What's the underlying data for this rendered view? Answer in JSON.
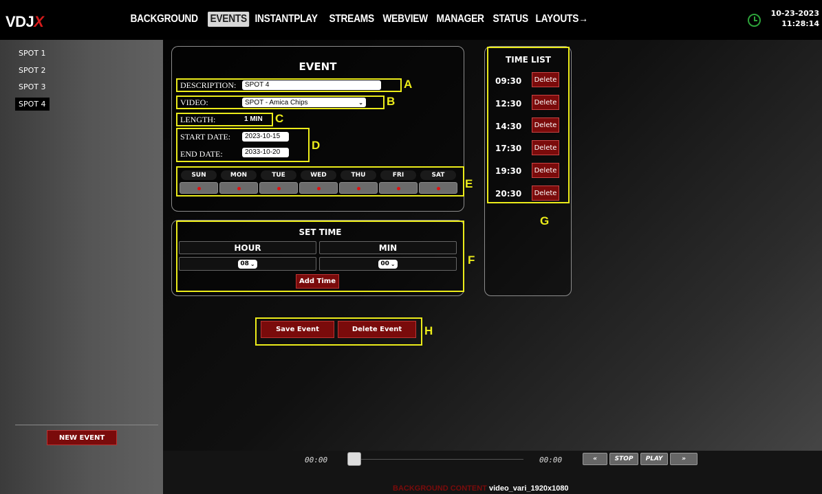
{
  "app": {
    "logo_main": "VDJ",
    "logo_accent": "X"
  },
  "nav": {
    "tabs": [
      "BACKGROUND",
      "EVENTS",
      "INSTANTPLAY",
      "STREAMS",
      "WEBVIEW",
      "MANAGER",
      "STATUS",
      "LAYOUTS→"
    ],
    "active_index": 1
  },
  "datetime": {
    "date": "10-23-2023",
    "time": "11:28:14"
  },
  "status_icon": "clock-icon",
  "sidebar": {
    "spots": [
      "SPOT 1",
      "SPOT 2",
      "SPOT 3",
      "SPOT 4"
    ],
    "active_index": 3,
    "new_event_label": "NEW EVENT"
  },
  "event": {
    "title": "EVENT",
    "description_label": "DESCRIPTION:",
    "description_value": "SPOT 4",
    "video_label": "VIDEO:",
    "video_value": "SPOT - Amica Chips",
    "length_label": "LENGTH:",
    "length_value": "1 MIN",
    "start_label": "START DATE:",
    "start_value": "2023-10-15",
    "end_label": "END DATE:",
    "end_value": "2033-10-20",
    "days": [
      "SUN",
      "MON",
      "TUE",
      "WED",
      "THU",
      "FRI",
      "SAT"
    ]
  },
  "set_time": {
    "title": "SET TIME",
    "hour_label": "HOUR",
    "min_label": "MIN",
    "hour_value": "08",
    "min_value": "00",
    "add_label": "Add Time"
  },
  "time_list": {
    "title": "TIME LIST",
    "times": [
      "09:30",
      "12:30",
      "14:30",
      "17:30",
      "19:30",
      "20:30"
    ],
    "delete_label": "Delete"
  },
  "actions": {
    "save_label": "Save Event",
    "delete_label": "Delete Event"
  },
  "annotations": {
    "A": "A",
    "B": "B",
    "C": "C",
    "D": "D",
    "E": "E",
    "F": "F",
    "G": "G",
    "H": "H"
  },
  "player": {
    "time_left": "00:00",
    "time_right": "00:00",
    "rewind_label": "«",
    "stop_label": "STOP",
    "play_label": "PLAY",
    "forward_label": "»",
    "progress": 0,
    "bg_content_label": "BACKGROUND CONTENT",
    "bg_content_value": "video_vari_1920x1080"
  },
  "colors": {
    "accent_red": "#7a0b0b",
    "highlight": "#ecec1a",
    "logo_accent": "#d61b1b",
    "clock_green": "#2da33a"
  }
}
